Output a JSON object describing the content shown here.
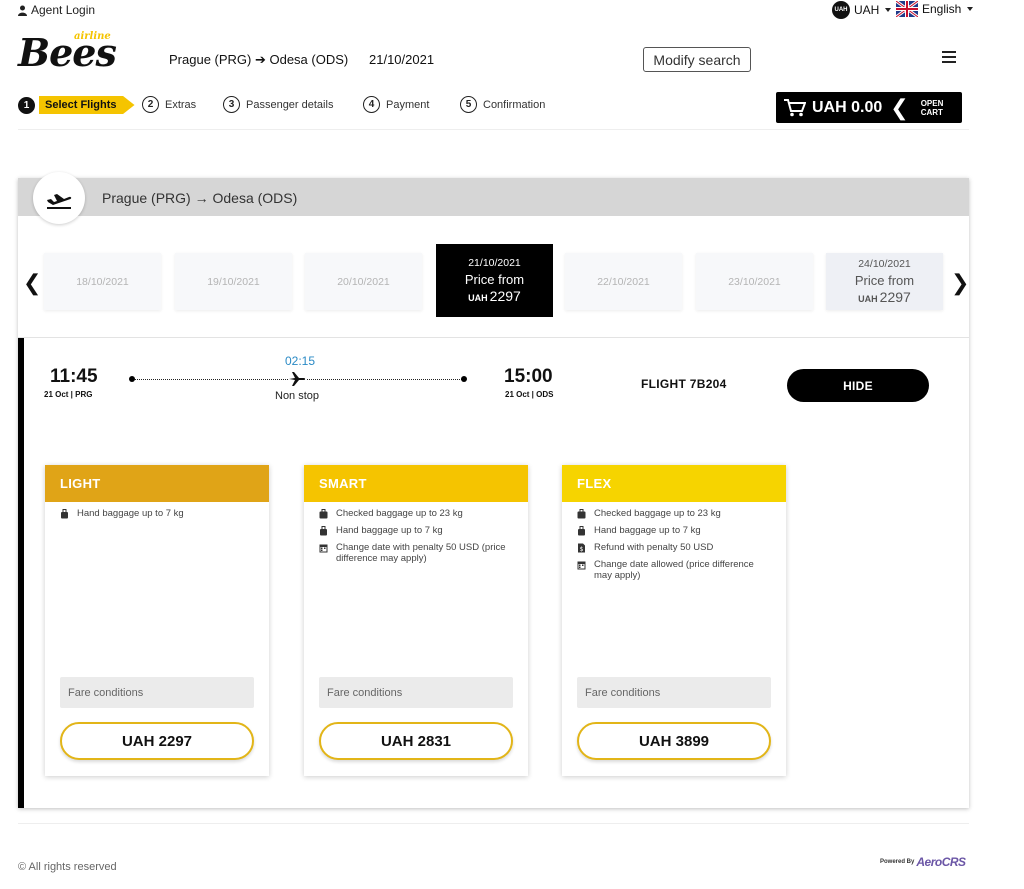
{
  "topbar": {
    "agent_login": "Agent Login",
    "currency_badge": "UAH",
    "currency": "UAH",
    "language": "English"
  },
  "header": {
    "logo_text": "Bees",
    "logo_sub": "airline",
    "route": "Prague (PRG) ➔ Odesa (ODS)",
    "date": "21/10/2021",
    "modify_label": "Modify search"
  },
  "steps": [
    {
      "num": "1",
      "label": "Select Flights"
    },
    {
      "num": "2",
      "label": "Extras"
    },
    {
      "num": "3",
      "label": "Passenger details"
    },
    {
      "num": "4",
      "label": "Payment"
    },
    {
      "num": "5",
      "label": "Confirmation"
    }
  ],
  "cart": {
    "amount": "UAH 0.00",
    "open_line1": "OPEN",
    "open_line2": "CART"
  },
  "flight_card": {
    "route": "Prague (PRG) → Odesa (ODS)",
    "dates": [
      {
        "date": "18/10/2021"
      },
      {
        "date": "19/10/2021"
      },
      {
        "date": "20/10/2021"
      },
      {
        "date": "21/10/2021",
        "price_from": "Price from",
        "currency": "UAH",
        "price": "2297"
      },
      {
        "date": "22/10/2021"
      },
      {
        "date": "23/10/2021"
      },
      {
        "date": "24/10/2021",
        "price_from": "Price from",
        "currency": "UAH",
        "price": "2297"
      }
    ],
    "departure_time": "11:45",
    "departure_sub": "21 Oct | PRG",
    "duration": "02:15",
    "stops": "Non stop",
    "arrival_time": "15:00",
    "arrival_sub": "21 Oct | ODS",
    "flight_number": "FLIGHT 7B204",
    "hide_label": "HIDE"
  },
  "fares": [
    {
      "name": "LIGHT",
      "color": "#e0a417",
      "features": [
        {
          "icon": "hand-baggage-icon",
          "text": "Hand baggage up to 7 kg"
        }
      ],
      "conditions": "Fare conditions",
      "price": "UAH 2297"
    },
    {
      "name": "SMART",
      "color": "#f5c400",
      "features": [
        {
          "icon": "checked-baggage-icon",
          "text": "Checked baggage up to 23 kg"
        },
        {
          "icon": "hand-baggage-icon",
          "text": "Hand baggage up to 7 kg"
        },
        {
          "icon": "calendar-icon",
          "text": "Change date with penalty 50 USD (price difference may apply)"
        }
      ],
      "conditions": "Fare conditions",
      "price": "UAH 2831"
    },
    {
      "name": "FLEX",
      "color": "#f6d400",
      "features": [
        {
          "icon": "checked-baggage-icon",
          "text": "Checked baggage up to 23 kg"
        },
        {
          "icon": "hand-baggage-icon",
          "text": "Hand baggage up to 7 kg"
        },
        {
          "icon": "refund-icon",
          "text": "Refund with penalty 50 USD"
        },
        {
          "icon": "calendar-icon",
          "text": "Change date allowed (price difference may apply)"
        }
      ],
      "conditions": "Fare conditions",
      "price": "UAH 3899"
    }
  ],
  "footer": {
    "rights": "© All rights reserved",
    "powered_by": "Powered By",
    "brand": "AeroCRS"
  }
}
